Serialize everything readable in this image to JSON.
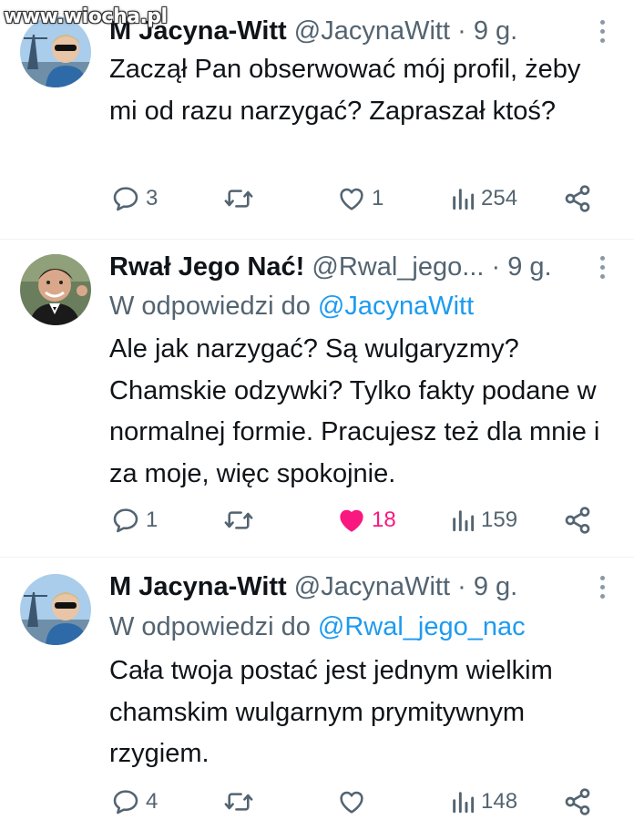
{
  "watermark": "www.wiocha.pl",
  "tweets": [
    {
      "name": "M Jacyna-Witt",
      "handle": "@JacynaWitt",
      "time": "9 g.",
      "reply_prefix": "",
      "reply_mention": "",
      "text": "Zaczął Pan obserwować mój profil, żeby mi od razu narzygać? Zapraszał ktoś?",
      "replies": "3",
      "reposts": "",
      "likes": "1",
      "liked": false,
      "views": "254"
    },
    {
      "name": "Rwał Jego Nać!",
      "handle": "@Rwal_jego...",
      "time": "9 g.",
      "reply_prefix": "W odpowiedzi do",
      "reply_mention": "@JacynaWitt",
      "text": "Ale jak narzygać? Są wulgaryzmy? Chamskie odzywki? Tylko fakty podane w normalnej formie. Pracujesz też dla mnie i za moje, więc spokojnie.",
      "replies": "1",
      "reposts": "",
      "likes": "18",
      "liked": true,
      "views": "159"
    },
    {
      "name": "M Jacyna-Witt",
      "handle": "@JacynaWitt",
      "time": "9 g.",
      "reply_prefix": "W odpowiedzi do",
      "reply_mention": "@Rwal_jego_nac",
      "text": "Cała twoja postać jest jednym wielkim chamskim wulgarnym prymitywnym rzygiem.",
      "replies": "4",
      "reposts": "",
      "likes": "",
      "liked": false,
      "views": "148"
    }
  ],
  "colors": {
    "text": "#0f1419",
    "secondary": "#536471",
    "mention": "#1d9bf0",
    "like_active": "#f91880"
  },
  "icons": [
    "reply-icon",
    "retweet-icon",
    "heart-icon",
    "views-icon",
    "share-icon",
    "more-icon"
  ]
}
